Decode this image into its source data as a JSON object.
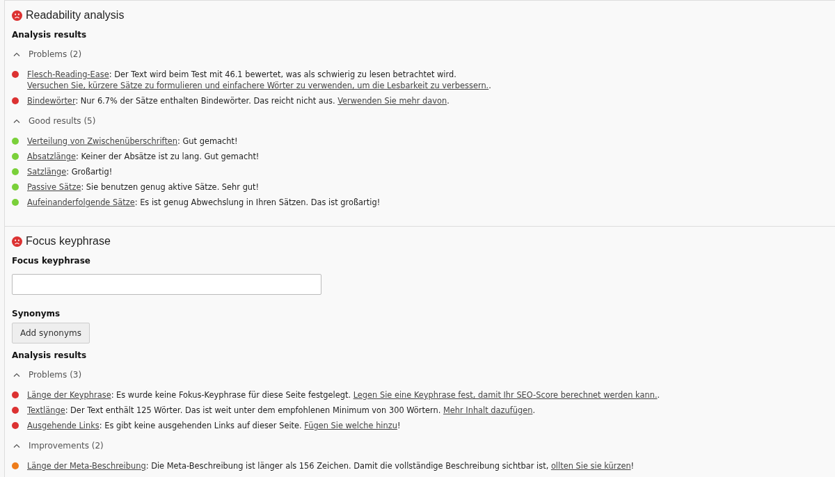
{
  "sections": [
    {
      "title": "Readability analysis",
      "color": "#dc3232",
      "results_label": "Analysis results",
      "groups": [
        {
          "title": "Problems (2)",
          "expanded": true,
          "items": [
            {
              "color": "#dc3232",
              "label": "Flesch-Reading-Ease",
              "text": ": Der Text wird beim Test mit 46.1 bewertet, was als schwierig zu lesen betrachtet wird. ",
              "action": "Versuchen Sie, kürzere Sätze zu formulieren und einfachere Wörter zu verwenden, um die Lesbarkeit zu verbessern.",
              "end": "."
            },
            {
              "color": "#dc3232",
              "label": "Bindewörter",
              "text": ": Nur 6.7% der Sätze enthalten Bindewörter. Das reicht nicht aus. ",
              "action": "Verwenden Sie mehr davon",
              "end": "."
            }
          ]
        },
        {
          "title": "Good results (5)",
          "expanded": true,
          "items": [
            {
              "color": "#7ad03a",
              "label": "Verteilung von Zwischenüberschriften",
              "text": ": Gut gemacht!"
            },
            {
              "color": "#7ad03a",
              "label": "Absatzlänge",
              "text": ": Keiner der Absätze ist zu lang. Gut gemacht!"
            },
            {
              "color": "#7ad03a",
              "label": "Satzlänge",
              "text": ": Großartig!"
            },
            {
              "color": "#7ad03a",
              "label": "Passive Sätze",
              "text": ": Sie benutzen genug aktive Sätze. Sehr gut!"
            },
            {
              "color": "#7ad03a",
              "label": "Aufeinanderfolgende Sätze",
              "text": ": Es ist genug Abwechslung in Ihren Sätzen. Das ist großartig!"
            }
          ]
        }
      ]
    },
    {
      "title": "Focus keyphrase",
      "color": "#dc3232",
      "keyphrase": {
        "label": "Focus keyphrase"
      },
      "synonyms": {
        "label": "Synonyms",
        "button": "Add synonyms"
      },
      "results_label": "Analysis results",
      "groups": [
        {
          "title": "Problems (3)",
          "expanded": true,
          "items": [
            {
              "color": "#dc3232",
              "label": "Länge der Keyphrase",
              "text": ": Es wurde keine Fokus-Keyphrase für diese Seite festgelegt. ",
              "action": "Legen Sie eine Keyphrase fest, damit Ihr SEO-Score berechnet werden kann.",
              "end": "."
            },
            {
              "color": "#dc3232",
              "label": "Textlänge",
              "text": ": Der Text enthält 125 Wörter. Das ist weit unter dem empfohlenen Minimum von 300 Wörtern. ",
              "action": "Mehr Inhalt dazufügen",
              "end": "."
            },
            {
              "color": "#dc3232",
              "label": "Ausgehende Links",
              "text": ": Es gibt keine ausgehenden Links auf dieser Seite. ",
              "action": "Fügen Sie welche hinzu",
              "end": "!"
            }
          ]
        },
        {
          "title": "Improvements (2)",
          "expanded": true,
          "items": [
            {
              "color": "#ee7c1b",
              "label": "Länge der Meta-Beschreibung",
              "text": ": Die Meta-Beschreibung ist länger als 156 Zeichen. Damit die vollständige Beschreibung sichtbar ist, ",
              "action": "ollten Sie sie kürzen",
              "end": "!"
            }
          ]
        }
      ]
    }
  ]
}
